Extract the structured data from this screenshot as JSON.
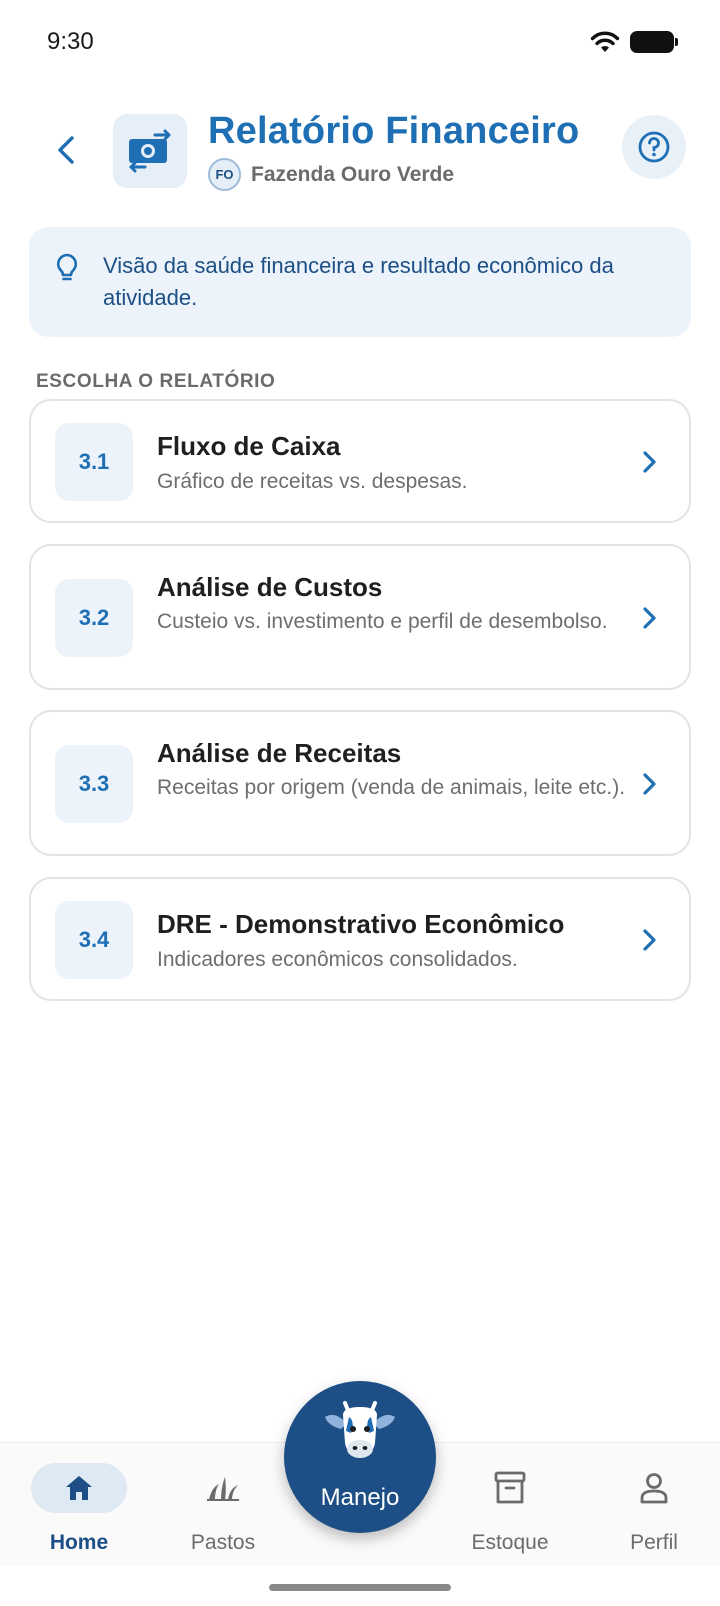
{
  "status_bar": {
    "time": "9:30"
  },
  "header": {
    "title": "Relatório Financeiro",
    "farm_initials": "FO",
    "farm_name": "Fazenda Ouro Verde"
  },
  "info": {
    "text": "Visão da saúde financeira e resultado econômico da atividade."
  },
  "section_label": "ESCOLHA O RELATÓRIO",
  "reports": [
    {
      "number": "3.1",
      "title": "Fluxo de Caixa",
      "description": "Gráfico de receitas vs. despesas."
    },
    {
      "number": "3.2",
      "title": "Análise de Custos",
      "description": "Custeio vs. investimento e perfil de desembolso."
    },
    {
      "number": "3.3",
      "title": "Análise de Receitas",
      "description": "Receitas por origem (venda de animais, leite etc.)."
    },
    {
      "number": "3.4",
      "title": "DRE - Demonstrativo Econômico",
      "description": "Indicadores econômicos consolidados."
    }
  ],
  "bottom_nav": {
    "items": [
      {
        "label": "Home",
        "icon": "home-icon",
        "active": true
      },
      {
        "label": "Pastos",
        "icon": "grass-icon",
        "active": false
      },
      {
        "label": "Estoque",
        "icon": "archive-icon",
        "active": false
      },
      {
        "label": "Perfil",
        "icon": "person-icon",
        "active": false
      }
    ],
    "center_label": "Manejo",
    "center_icon": "cow-icon"
  },
  "colors": {
    "primary": "#1f6fb5",
    "primary_dark": "#1d4f86",
    "tint_bg": "#edf3fa",
    "muted_text": "#6e6e6e"
  }
}
